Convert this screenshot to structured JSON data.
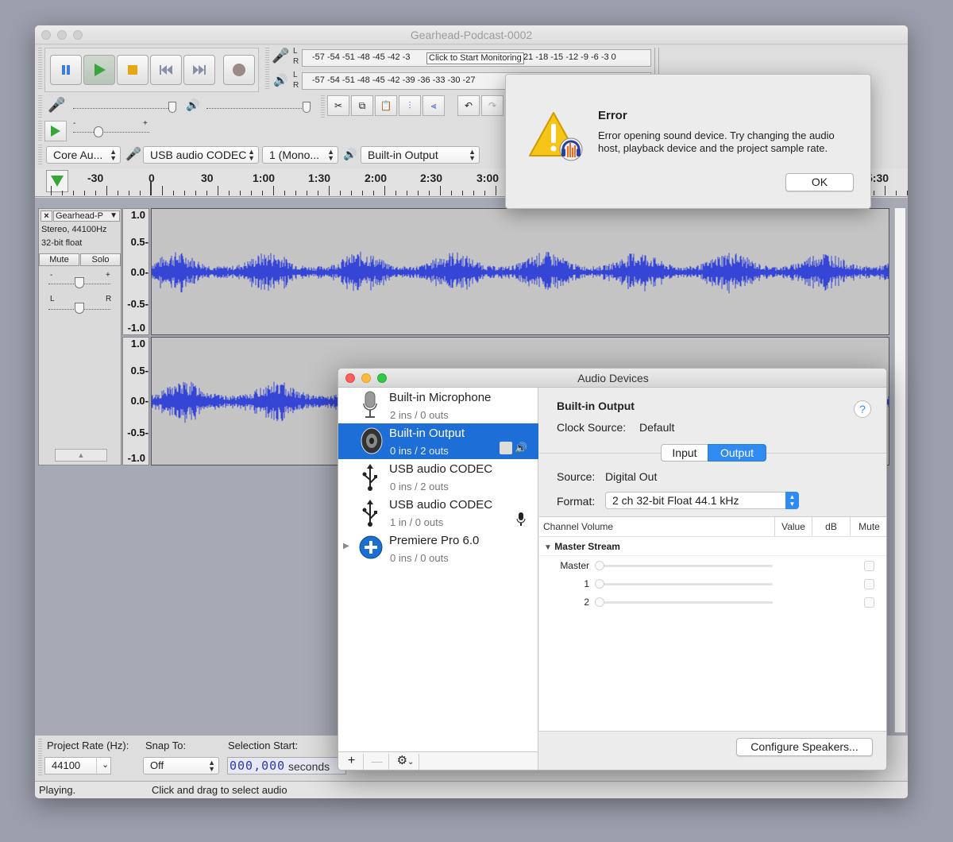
{
  "main_window": {
    "title": "Gearhead-Podcast-0002",
    "meters": {
      "rec_label_l": "L",
      "rec_label_r": "R",
      "play_label_l": "L",
      "play_label_r": "R",
      "rec_scale_left": "-57 -54 -51 -48 -45 -42 -3",
      "monitor_label": "Click to Start Monitoring",
      "rec_scale_right": "21 -18 -15 -12 -9 -6 -3 0",
      "play_scale": "-57 -54 -51 -48 -45 -42 -39 -36 -33 -30 -27"
    },
    "gain_scale": {
      "minus": "-",
      "plus": "+"
    },
    "device_toolbar": {
      "host": "Core Au...",
      "recording_device": "USB audio CODEC",
      "channels": "1 (Mono...",
      "playback_device": "Built-in Output"
    },
    "ruler": [
      "-30",
      "0",
      "30",
      "1:00",
      "1:30",
      "2:00",
      "2:30",
      "3:00",
      "5:30"
    ],
    "track": {
      "name": "Gearhead-P",
      "info_line1": "Stereo, 44100Hz",
      "info_line2": "32-bit float",
      "mute": "Mute",
      "solo": "Solo",
      "gain_minus": "-",
      "gain_plus": "+",
      "pan_l": "L",
      "pan_r": "R",
      "scale": [
        "1.0",
        "0.5-",
        "0.0-",
        "-0.5-",
        "-1.0"
      ]
    },
    "selection_toolbar": {
      "project_rate_label": "Project Rate (Hz):",
      "project_rate_value": "44100",
      "snap_label": "Snap To:",
      "snap_value": "Off",
      "selection_start_label": "Selection Start:",
      "selection_start_value": "000,000",
      "selection_start_units": "seconds"
    },
    "status": {
      "left": "Playing.",
      "right": "Click and drag to select audio"
    }
  },
  "error_dialog": {
    "title": "Error",
    "message": "Error opening sound device. Try changing the audio host, playback device and the project sample rate.",
    "ok": "OK"
  },
  "audio_devices": {
    "title": "Audio Devices",
    "devices": [
      {
        "name": "Built-in Microphone",
        "io": "2 ins / 0 outs",
        "icon": "microphone-icon"
      },
      {
        "name": "Built-in Output",
        "io": "0 ins / 2 outs",
        "icon": "speaker-icon"
      },
      {
        "name": "USB audio CODEC",
        "io": "0 ins / 2 outs",
        "icon": "usb-icon"
      },
      {
        "name": "USB audio CODEC",
        "io": "1 in / 0 outs",
        "icon": "usb-icon"
      },
      {
        "name": "Premiere Pro 6.0",
        "io": "0 ins / 0 outs",
        "icon": "plus-circle-icon"
      }
    ],
    "detail": {
      "name": "Built-in Output",
      "clock_source_label": "Clock Source:",
      "clock_source_value": "Default",
      "tab_input": "Input",
      "tab_output": "Output",
      "source_label": "Source:",
      "source_value": "Digital Out",
      "format_label": "Format:",
      "format_value": "2 ch 32-bit Float 44.1 kHz",
      "columns": [
        "Channel Volume",
        "Value",
        "dB",
        "Mute"
      ],
      "master_stream": "Master Stream",
      "channels": [
        "Master",
        "1",
        "2"
      ],
      "help": "?",
      "configure_speakers": "Configure Speakers..."
    },
    "bottom_buttons": {
      "add": "+",
      "remove": "—"
    }
  }
}
